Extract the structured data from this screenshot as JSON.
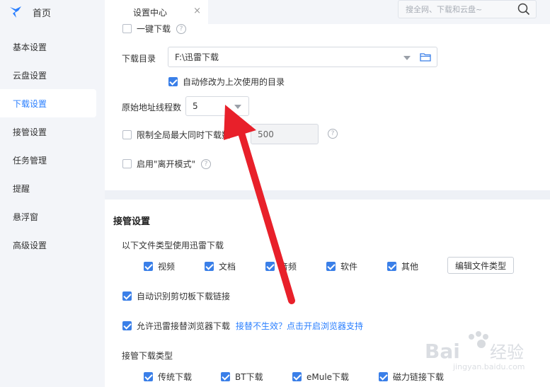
{
  "sidebar": {
    "home_label": "首页",
    "items": [
      {
        "label": "基本设置"
      },
      {
        "label": "云盘设置"
      },
      {
        "label": "下载设置",
        "active": true
      },
      {
        "label": "接管设置"
      },
      {
        "label": "任务管理"
      },
      {
        "label": "提醒"
      },
      {
        "label": "悬浮窗"
      },
      {
        "label": "高级设置"
      }
    ]
  },
  "topbar": {
    "tab_label": "设置中心",
    "tab_close": "×",
    "search_placeholder": "搜全网、下载和云盘~"
  },
  "download": {
    "one_click_label": "一键下载",
    "dir_label": "下载目录",
    "dir_value": "F:\\迅雷下载",
    "auto_modify_label": "自动修改为上次使用的目录",
    "threads_label": "原始地址线程数",
    "threads_value": "5",
    "limit_label": "限制全局最大同时下载数",
    "limit_value": "500",
    "away_mode_label": "启用\"离开模式\""
  },
  "takeover": {
    "section_title": "接管设置",
    "file_types_label": "以下文件类型使用迅雷下载",
    "file_types": [
      "视频",
      "文档",
      "音频",
      "软件",
      "其他"
    ],
    "edit_types_button": "编辑文件类型",
    "clipboard_label": "自动识别剪切板下载链接",
    "browser_label": "允许迅雷接替浏览器下载",
    "browser_link": "接替不生效？点击开启浏览器支持",
    "download_types_label": "接管下载类型",
    "download_types": [
      "传统下载",
      "BT下载",
      "eMule下载",
      "磁力链接下载"
    ]
  },
  "colors": {
    "accent": "#2a7fff",
    "checkbox": "#3a7fe8",
    "arrow": "#e8202a"
  }
}
